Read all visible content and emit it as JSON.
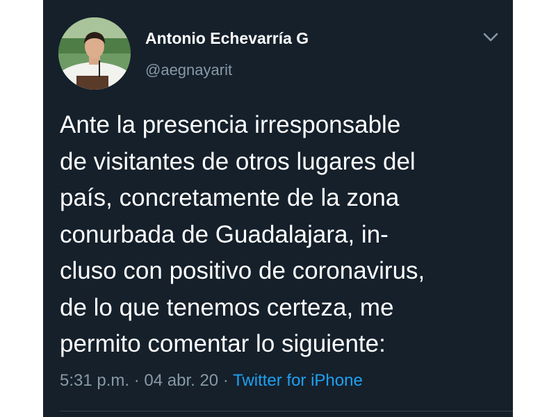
{
  "author": {
    "display_name": "Antonio Echevarría G",
    "handle": "@aegnayarit"
  },
  "tweet": {
    "text": "Ante la presencia irresponsable\nde visitantes de otros lugares del\npaís, concretamente de la zona\nconurbada de Guadalajara, in-\ncluso con positivo de coronavirus,\nde lo que tenemos certeza,  me\npermito comentar lo siguiente:",
    "time": "5:31 p.m.",
    "date": "04 abr. 20",
    "separator": " · ",
    "source": "Twitter for iPhone"
  },
  "icons": {
    "menu": "chevron-down-icon"
  },
  "colors": {
    "background": "#15202b",
    "text": "#ffffff",
    "secondary": "#8899a6",
    "link": "#1da1f2"
  }
}
